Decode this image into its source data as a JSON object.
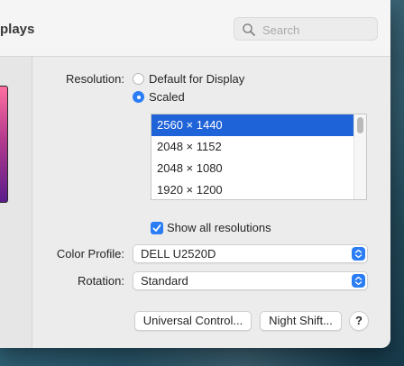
{
  "window": {
    "title": "plays"
  },
  "search": {
    "placeholder": "Search",
    "icon": "magnifier"
  },
  "resolution": {
    "label": "Resolution:",
    "options": [
      "Default for Display",
      "Scaled"
    ],
    "selected": "Scaled",
    "list": [
      "2560 × 1440",
      "2048 × 1152",
      "2048 × 1080",
      "1920 × 1200"
    ],
    "selected_item": "2560 × 1440"
  },
  "show_all": {
    "label": "Show all resolutions",
    "checked": true
  },
  "color_profile": {
    "label": "Color Profile:",
    "value": "DELL U2520D"
  },
  "rotation": {
    "label": "Rotation:",
    "value": "Standard"
  },
  "buttons": {
    "universal": "Universal Control...",
    "night": "Night Shift...",
    "help": "?"
  },
  "colors": {
    "accent": "#2b7df5",
    "selection": "#1f63d8"
  }
}
